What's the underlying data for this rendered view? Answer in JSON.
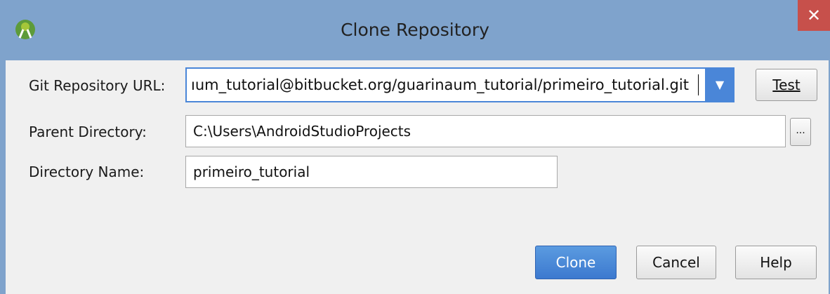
{
  "window": {
    "title": "Clone Repository",
    "close_glyph": "✕",
    "app_icon": "android-studio-icon"
  },
  "form": {
    "git_url_label": "Git Repository URL:",
    "git_url_value": "ıum_tutorial@bitbucket.org/guarinaum_tutorial/primeiro_tutorial.git",
    "test_label": "Test",
    "parent_dir_label": "Parent Directory:",
    "parent_dir_value": "C:\\Users\\AndroidStudioProjects",
    "browse_label": "...",
    "dir_name_label": "Directory Name:",
    "dir_name_value": "primeiro_tutorial"
  },
  "buttons": {
    "clone": "Clone",
    "cancel": "Cancel",
    "help": "Help"
  },
  "colors": {
    "title_bar": "#7fa3cc",
    "close_button": "#c7504b",
    "accent": "#4a86d8"
  }
}
